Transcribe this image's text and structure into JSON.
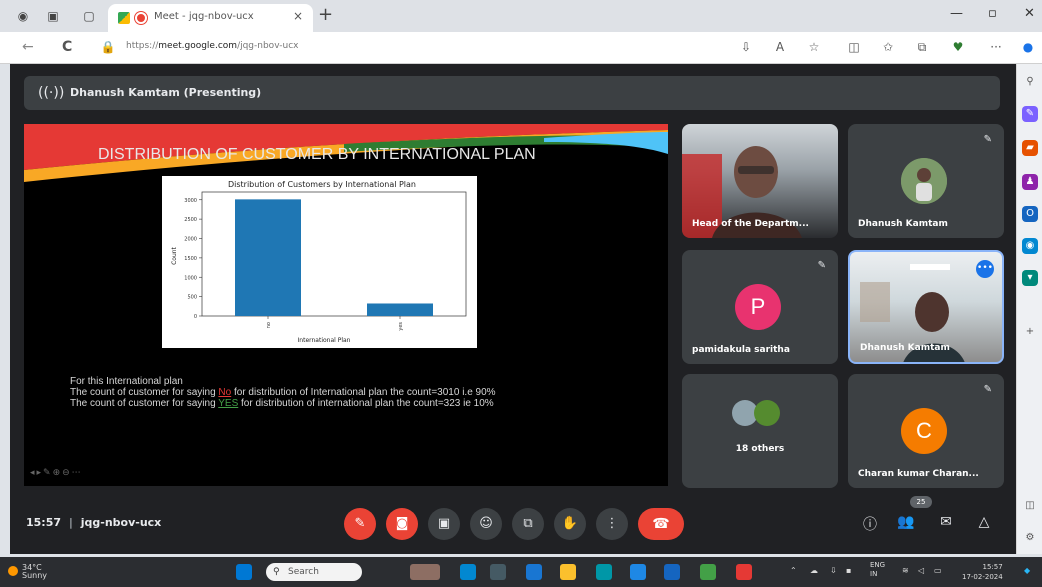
{
  "browser": {
    "tab_title": "Meet - jqg-nbov-ucx",
    "tab_close": "×",
    "new_tab": "+",
    "url_prefix": "https://",
    "url_host": "meet.google.com",
    "url_path": "/jqg-nbov-ucx",
    "window_buttons": {
      "minimize": "—",
      "maximize": "▫",
      "close": "✕"
    },
    "back": "←",
    "reload": "C",
    "more": "···"
  },
  "meet": {
    "presenter_label": "Dhanush Kamtam (Presenting)",
    "slide": {
      "title": "DISTRIBUTION OF CUSTOMER BY INTERNATIONAL PLAN",
      "text_line1": "For this International plan",
      "text_line2_a": "The count of customer for saying ",
      "text_line2_no": "No",
      "text_line2_b": " for distribution of  International plan the count=3010 i.e  90%",
      "text_line3_a": "The count of customer for saying ",
      "text_line3_yes": "YES",
      "text_line3_b": " for distribution of international plan the count=323 ie 10%"
    },
    "tiles": {
      "head": {
        "name": "Head of the Departm..."
      },
      "dhanush": {
        "name": "Dhanush Kamtam"
      },
      "pamidakula": {
        "name": "pamidakula saritha",
        "initial": "P",
        "color": "#e8336f"
      },
      "active": {
        "name": "Dhanush Kamtam"
      },
      "others": {
        "label": "18 others"
      },
      "charan": {
        "name": "Charan kumar Charan...",
        "initial": "C",
        "color": "#f57c00"
      }
    },
    "bottom": {
      "time": "15:57",
      "separator": "|",
      "meeting_code": "jqg-nbov-ucx",
      "participant_count": "25"
    }
  },
  "chart_data": {
    "type": "bar",
    "title": "Distribution of Customers by International Plan",
    "xlabel": "International Plan",
    "ylabel": "Count",
    "categories": [
      "no",
      "yes"
    ],
    "values": [
      3010,
      323
    ],
    "ylim": [
      0,
      3200
    ],
    "yticks": [
      0,
      500,
      1000,
      1500,
      2000,
      2500,
      3000
    ],
    "bar_color": "#1f77b4"
  },
  "taskbar": {
    "temperature": "34°C",
    "condition": "Sunny",
    "search_placeholder": "Search",
    "lang_1": "ENG",
    "lang_2": "IN",
    "time": "15:57",
    "date": "17-02-2024"
  }
}
